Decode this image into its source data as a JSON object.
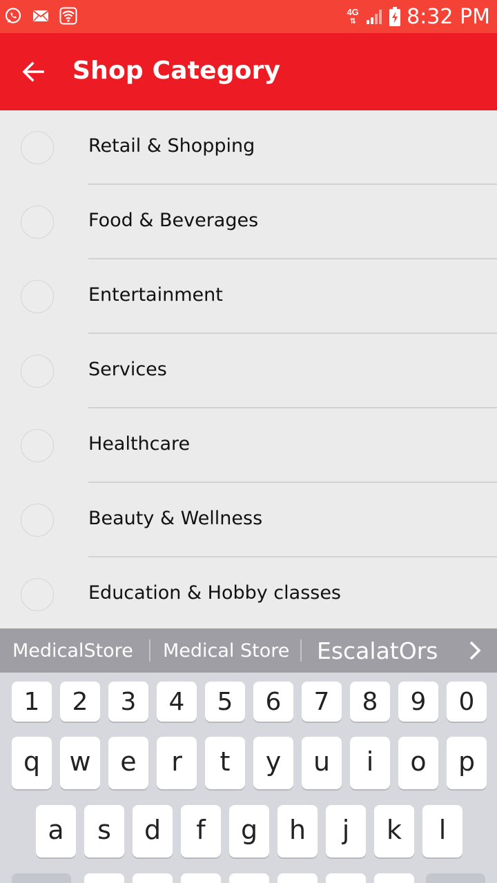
{
  "status_bar": {
    "time": "8:32 PM",
    "network": "4G",
    "icons": [
      "whatsapp-icon",
      "mail-icon",
      "wifi-icon",
      "signal-icon",
      "battery-charging-icon"
    ]
  },
  "app_bar": {
    "title": "Shop Category",
    "back_icon": "arrow-left-icon",
    "color": "#ed1c24"
  },
  "categories": [
    {
      "label": "Retail & Shopping"
    },
    {
      "label": "Food & Beverages"
    },
    {
      "label": "Entertainment"
    },
    {
      "label": "Services"
    },
    {
      "label": "Healthcare"
    },
    {
      "label": "Beauty & Wellness"
    },
    {
      "label": "Education & Hobby classes"
    }
  ],
  "keyboard": {
    "suggestions": [
      "MedicalStore",
      "Medical Store",
      "EscalatOrs"
    ],
    "more_icon": "chevron-right-icon",
    "number_row": [
      "1",
      "2",
      "3",
      "4",
      "5",
      "6",
      "7",
      "8",
      "9",
      "0"
    ],
    "row1": [
      "q",
      "w",
      "e",
      "r",
      "t",
      "y",
      "u",
      "i",
      "o",
      "p"
    ],
    "row2": [
      "a",
      "s",
      "d",
      "f",
      "g",
      "h",
      "j",
      "k",
      "l"
    ]
  },
  "colors": {
    "status_bar": "#f44336",
    "app_bar": "#ed1c24",
    "list_background": "#ebebeb",
    "keyboard_background": "#d6d8de",
    "suggestion_strip": "#9e9ea4"
  }
}
